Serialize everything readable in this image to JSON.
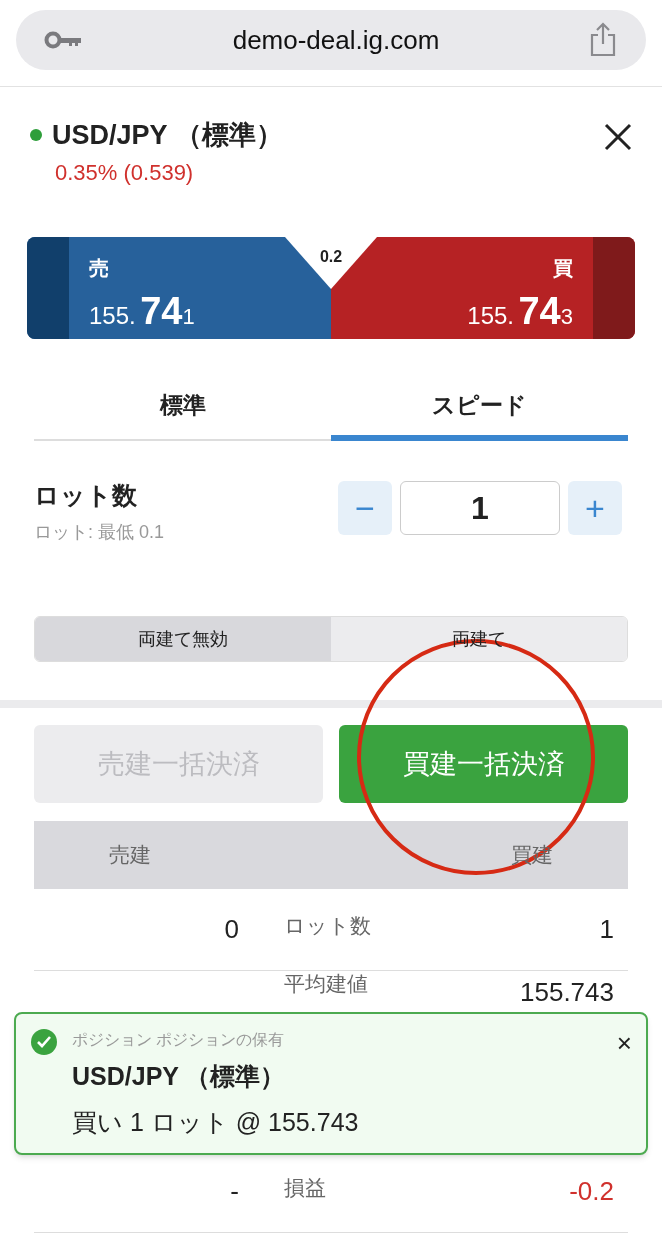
{
  "browser": {
    "url": "demo-deal.ig.com"
  },
  "header": {
    "title": "USD/JPY （標準）",
    "change": "0.35% (0.539)"
  },
  "prices": {
    "spread": "0.2",
    "sell": {
      "label": "売",
      "prefix": "155.",
      "big": "74",
      "suffix": "1"
    },
    "buy": {
      "label": "買",
      "prefix": "155.",
      "big": "74",
      "suffix": "3"
    }
  },
  "tabs": [
    {
      "label": "標準",
      "selected": false
    },
    {
      "label": "スピード",
      "selected": true
    }
  ],
  "lot": {
    "label": "ロット数",
    "hint": "ロット: 最低 0.1",
    "minus": "−",
    "value": "1",
    "plus": "+"
  },
  "hedge": [
    {
      "label": "両建て無効",
      "selected": true
    },
    {
      "label": "両建て",
      "selected": false
    }
  ],
  "close_buttons": [
    {
      "label": "売建一括決済",
      "disabled": true
    },
    {
      "label": "買建一括決済",
      "disabled": false
    }
  ],
  "table": {
    "columns": [
      "売建",
      "買建"
    ],
    "rows": [
      {
        "sell": "0",
        "label": "ロット数",
        "buy": "1",
        "negative": false
      },
      {
        "sell": "",
        "label": "平均建値",
        "buy": "155.743",
        "negative": false
      },
      {
        "sell": "-",
        "label": "損益",
        "buy": "-0.2",
        "negative": true
      }
    ]
  },
  "toast": {
    "category": "ポジション ポジションの保有",
    "title": "USD/JPY （標準）",
    "detail": "買い 1 ロット @ 155.743",
    "close": "×"
  }
}
